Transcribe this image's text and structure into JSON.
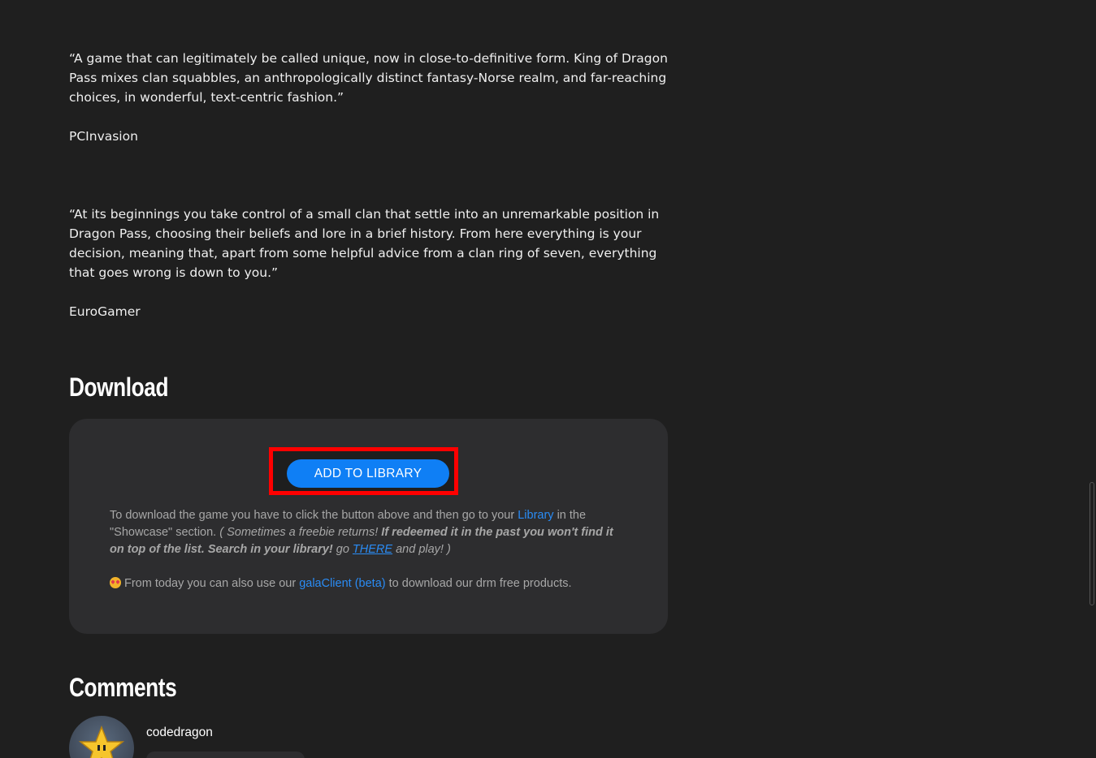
{
  "reviews": [
    {
      "quote": "“A game that can legitimately be called unique, now in close-to-definitive form. King of Dragon Pass mixes clan squabbles, an anthropologically distinct fantasy-Norse realm, and far-reaching choices, in wonderful, text-centric fashion.”",
      "source": "PCInvasion"
    },
    {
      "quote": "“At its beginnings you take control of a small clan that settle into an unremarkable position in Dragon Pass, choosing their beliefs and lore in a brief history. From here everything is your decision, meaning that, apart from some helpful advice from a clan ring of seven, everything that goes wrong is down to you.”",
      "source": "EuroGamer"
    }
  ],
  "download": {
    "title": "Download",
    "button_label": "ADD TO LIBRARY",
    "info": {
      "text1": "To download the game you have to click the button above and then go to your ",
      "library_link": "Library",
      "text2": " in the \"Showcase\" section. ",
      "italic1": "( Sometimes a freebie returns! ",
      "bold1": "If redeemed it in the past you won't find it on top of the list. Search in your library!",
      "italic2": " go ",
      "there_link": "THERE",
      "italic3": " and play! )"
    },
    "client": {
      "text1": "From today you can also use our ",
      "client_link": "galaClient (beta)",
      "text2": " to download our drm free products."
    }
  },
  "comments": {
    "title": "Comments",
    "items": [
      {
        "username": "codedragon"
      }
    ]
  },
  "colors": {
    "background": "#1f1f1f",
    "card": "#2d2d2f",
    "accent": "#0f7ff5",
    "link": "#2a8cf5",
    "highlight": "#ff0000"
  }
}
